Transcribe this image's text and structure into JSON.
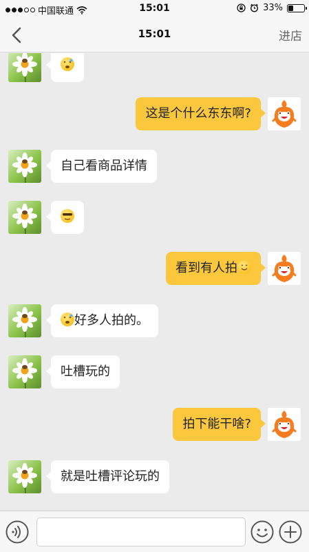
{
  "status_bar": {
    "carrier": "中国联通",
    "time": "15:01",
    "battery": "33%",
    "battery_level": 0.33
  },
  "nav": {
    "title": "15:01",
    "shop_label": "进店"
  },
  "messages": [
    {
      "side": "in",
      "text": ""
    },
    {
      "side": "out",
      "text": "这是个什么东东啊?"
    },
    {
      "side": "in",
      "text": "自己看商品详情"
    },
    {
      "side": "in",
      "text": ""
    },
    {
      "side": "out",
      "text": "看到有人拍"
    },
    {
      "side": "in",
      "text": "好多人拍的。"
    },
    {
      "side": "in",
      "text": "吐槽玩的"
    },
    {
      "side": "out",
      "text": "拍下能干啥?"
    },
    {
      "side": "in",
      "text": "就是吐槽评论玩的"
    }
  ],
  "input": {
    "value": "",
    "placeholder": ""
  },
  "icons": {
    "back": "chevron-left-icon",
    "voice": "voice-icon",
    "emoji": "smiley-icon",
    "plus": "plus-icon"
  },
  "colors": {
    "incoming_bubble": "#ffffff",
    "outgoing_bubble": "#fbc73c",
    "background": "#ebebeb"
  }
}
